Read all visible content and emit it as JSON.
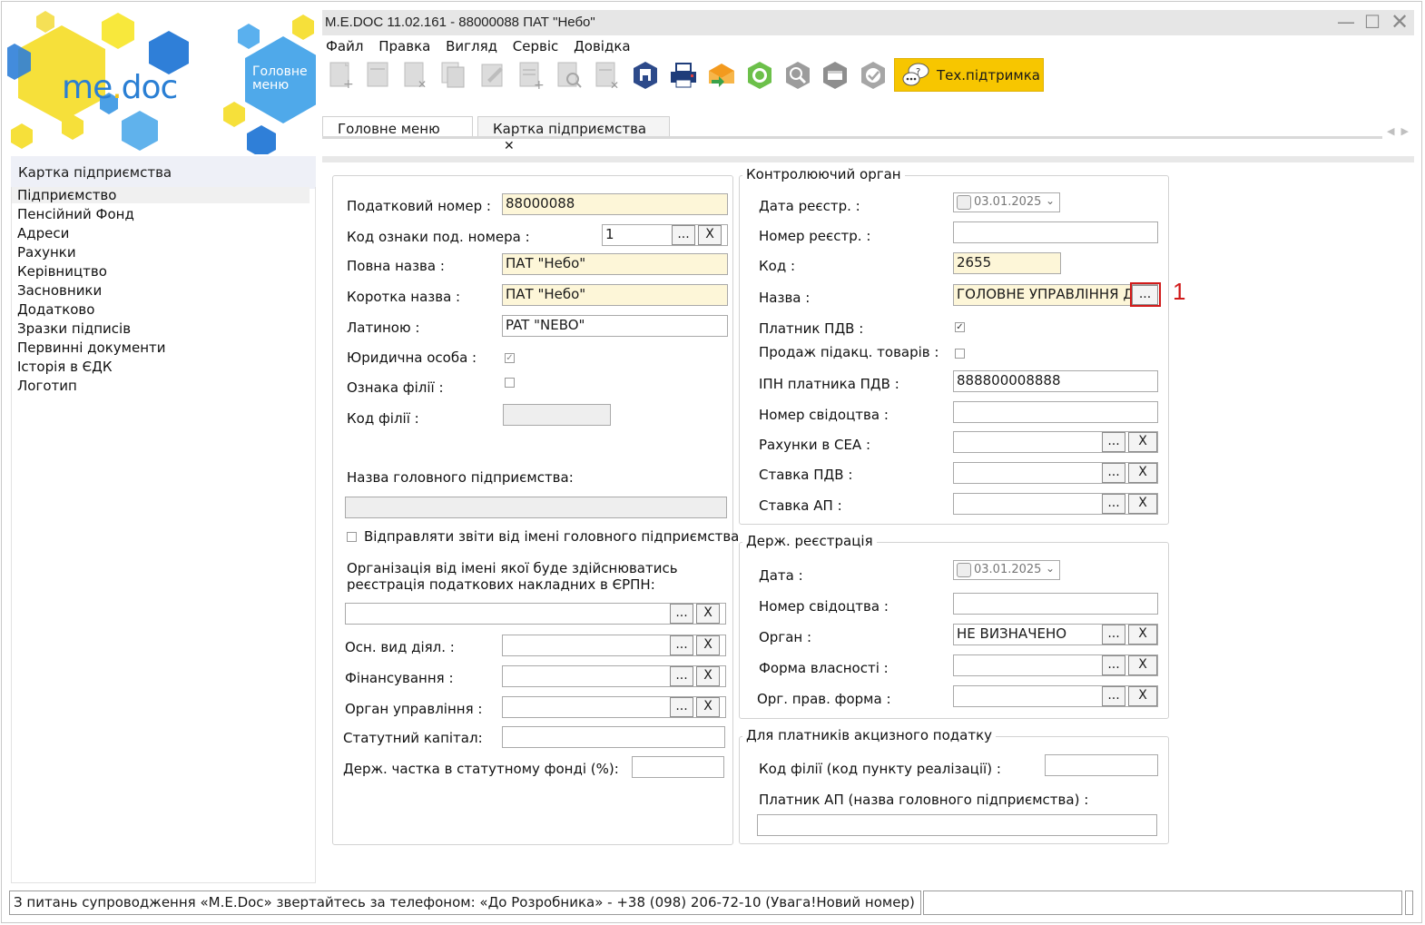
{
  "window": {
    "title": "M.E.DOC 11.02.161  - 88000088 ПАТ \"Небо\"",
    "min_icon": "minimize-icon",
    "max_icon": "maximize-icon",
    "close_icon": "close-icon"
  },
  "logo": {
    "me": "me",
    "doc": "doc",
    "main_menu_line1": "Головне",
    "main_menu_line2": "меню"
  },
  "menubar": [
    "Файл",
    "Правка",
    "Вигляд",
    "Сервіс",
    "Довідка"
  ],
  "toolbar": {
    "icons": [
      "new-document-icon",
      "open-document-icon",
      "delete-document-icon",
      "copy-icon",
      "edit-icon",
      "add-row-icon",
      "search-document-icon",
      "remove-row-icon",
      "save-icon",
      "print-icon",
      "send-icon",
      "receive-icon",
      "lookup-icon",
      "archive-icon",
      "verify-icon"
    ],
    "support_label": "Тех.підтримка"
  },
  "tabs": [
    {
      "label": "Головне меню"
    },
    {
      "label": "Картка підприємства",
      "close": "✕"
    }
  ],
  "sidebar": {
    "title": "Картка підприємства",
    "items": [
      "Підприємство",
      "Пенсійний Фонд",
      "Адреси",
      "Рахунки",
      "Керівництво",
      "Засновники",
      "Додатково",
      "Зразки підписів",
      "Первинні документи",
      "Історія в ЄДК",
      "Логотип"
    ],
    "selected": "Підприємство"
  },
  "left_form": {
    "tax_number_label": "Податковий номер :",
    "tax_number": "88000088",
    "code_sign_label": "Код ознаки под. номера :",
    "code_sign": "1",
    "full_name_label": "Повна назва :",
    "full_name": "ПАТ \"Небо\"",
    "short_name_label": "Коротка назва :",
    "short_name": "ПАТ \"Небо\"",
    "latin_label": "Латиною :",
    "latin": "PAT \"NEBO\"",
    "legal_entity_label": "Юридична особа :",
    "legal_entity_checked": true,
    "branch_sign_label": "Ознака філії :",
    "branch_sign_checked": false,
    "branch_code_label": "Код філії :",
    "branch_code": "",
    "head_company_label": "Назва головного підприємства:",
    "head_company": "",
    "send_reports_label": "Відправляти звіти від імені головного підприємства",
    "org_reg_label_1": "Організація від імені якої буде здійснюватись",
    "org_reg_label_2": "реєстрація податкових накладних в ЄРПН:",
    "org_reg_value": "",
    "main_activity_label": "Осн. вид діял. :",
    "financing_label": "Фінансування :",
    "management_label": "Орган управління :",
    "capital_label": "Статутний капітал:",
    "state_share_label": "Держ. частка в статутному фонді (%):",
    "dots": "...",
    "x": "X"
  },
  "control_body": {
    "title": "Контролюючий орган",
    "reg_date_label": "Дата реєстр. :",
    "reg_date": "03.01.2025",
    "reg_number_label": "Номер реєстр. :",
    "reg_number": "",
    "code_label": "Код :",
    "code": "2655",
    "name_label": "Назва :",
    "name": "ГОЛОВНЕ УПРАВЛІННЯ ДПС",
    "vat_payer_label": "Платник ПДВ :",
    "vat_payer_checked": true,
    "excise_sale_label": "Продаж підакц. товарів :",
    "excise_sale_checked": false,
    "ipn_label": "ІПН платника ПДВ :",
    "ipn": "888800008888",
    "cert_number_label": "Номер свідоцтва :",
    "cert_number": "",
    "sea_accounts_label": "Рахунки в СЕА :",
    "vat_rate_label": "Ставка ПДВ :",
    "ap_rate_label": "Ставка АП :"
  },
  "state_reg": {
    "title": "Держ. реєстрація",
    "date_label": "Дата :",
    "date": "03.01.2025",
    "cert_label": "Номер свідоцтва :",
    "body_label": "Орган :",
    "body": "НЕ ВИЗНАЧЕНО",
    "ownership_label": "Форма власності :",
    "legal_form_label": "Орг. прав. форма :"
  },
  "excise": {
    "title": "Для платників акцизного податку",
    "branch_code_label": "Код філії (код пункту реалізації) :",
    "ap_payer_label": "Платник АП (назва головного підприємства) :"
  },
  "annotation": {
    "number": "1",
    "color": "#d11a1a"
  },
  "status": {
    "message": "З питань супроводження «M.E.Doc» звертайтесь за телефоном: «До Розробника» - +38 (098) 206-72-10 (Увага!Новий номер)"
  },
  "colors": {
    "accent_yellow": "#f7c600",
    "field_yellow": "#fdf6d8",
    "logo_blue": "#2a7fd4"
  }
}
